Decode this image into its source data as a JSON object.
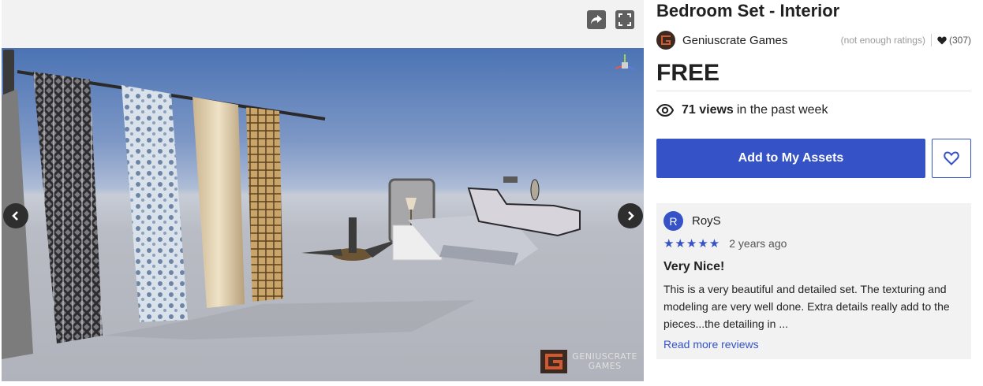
{
  "product": {
    "title": "Bedroom Set - Interior",
    "publisher": "Geniuscrate Games",
    "ratings_note": "(not enough ratings)",
    "favorites_count": "(307)",
    "price": "FREE",
    "views_count": "71 views",
    "views_suffix": "in the past week"
  },
  "actions": {
    "add_label": "Add to My Assets"
  },
  "review": {
    "avatar_letter": "R",
    "user": "RoyS",
    "stars": "★★★★★",
    "rating": 5,
    "date": "2 years ago",
    "title": "Very Nice!",
    "body": "This is a very beautiful and detailed set.  The texturing and modeling are very well done.  Extra details really add to the pieces...the detailing in ...",
    "read_more": "Read more reviews"
  },
  "media": {
    "brand_line1": "GENIUSCRATE",
    "brand_line2": "GAMES"
  },
  "colors": {
    "accent": "#3553c7",
    "review_bg": "#f2f2f2"
  },
  "icons": [
    "share-icon",
    "fullscreen-icon",
    "chevron-left-icon",
    "chevron-right-icon",
    "eye-icon",
    "heart-icon",
    "heart-outline-icon",
    "publisher-logo-icon"
  ]
}
